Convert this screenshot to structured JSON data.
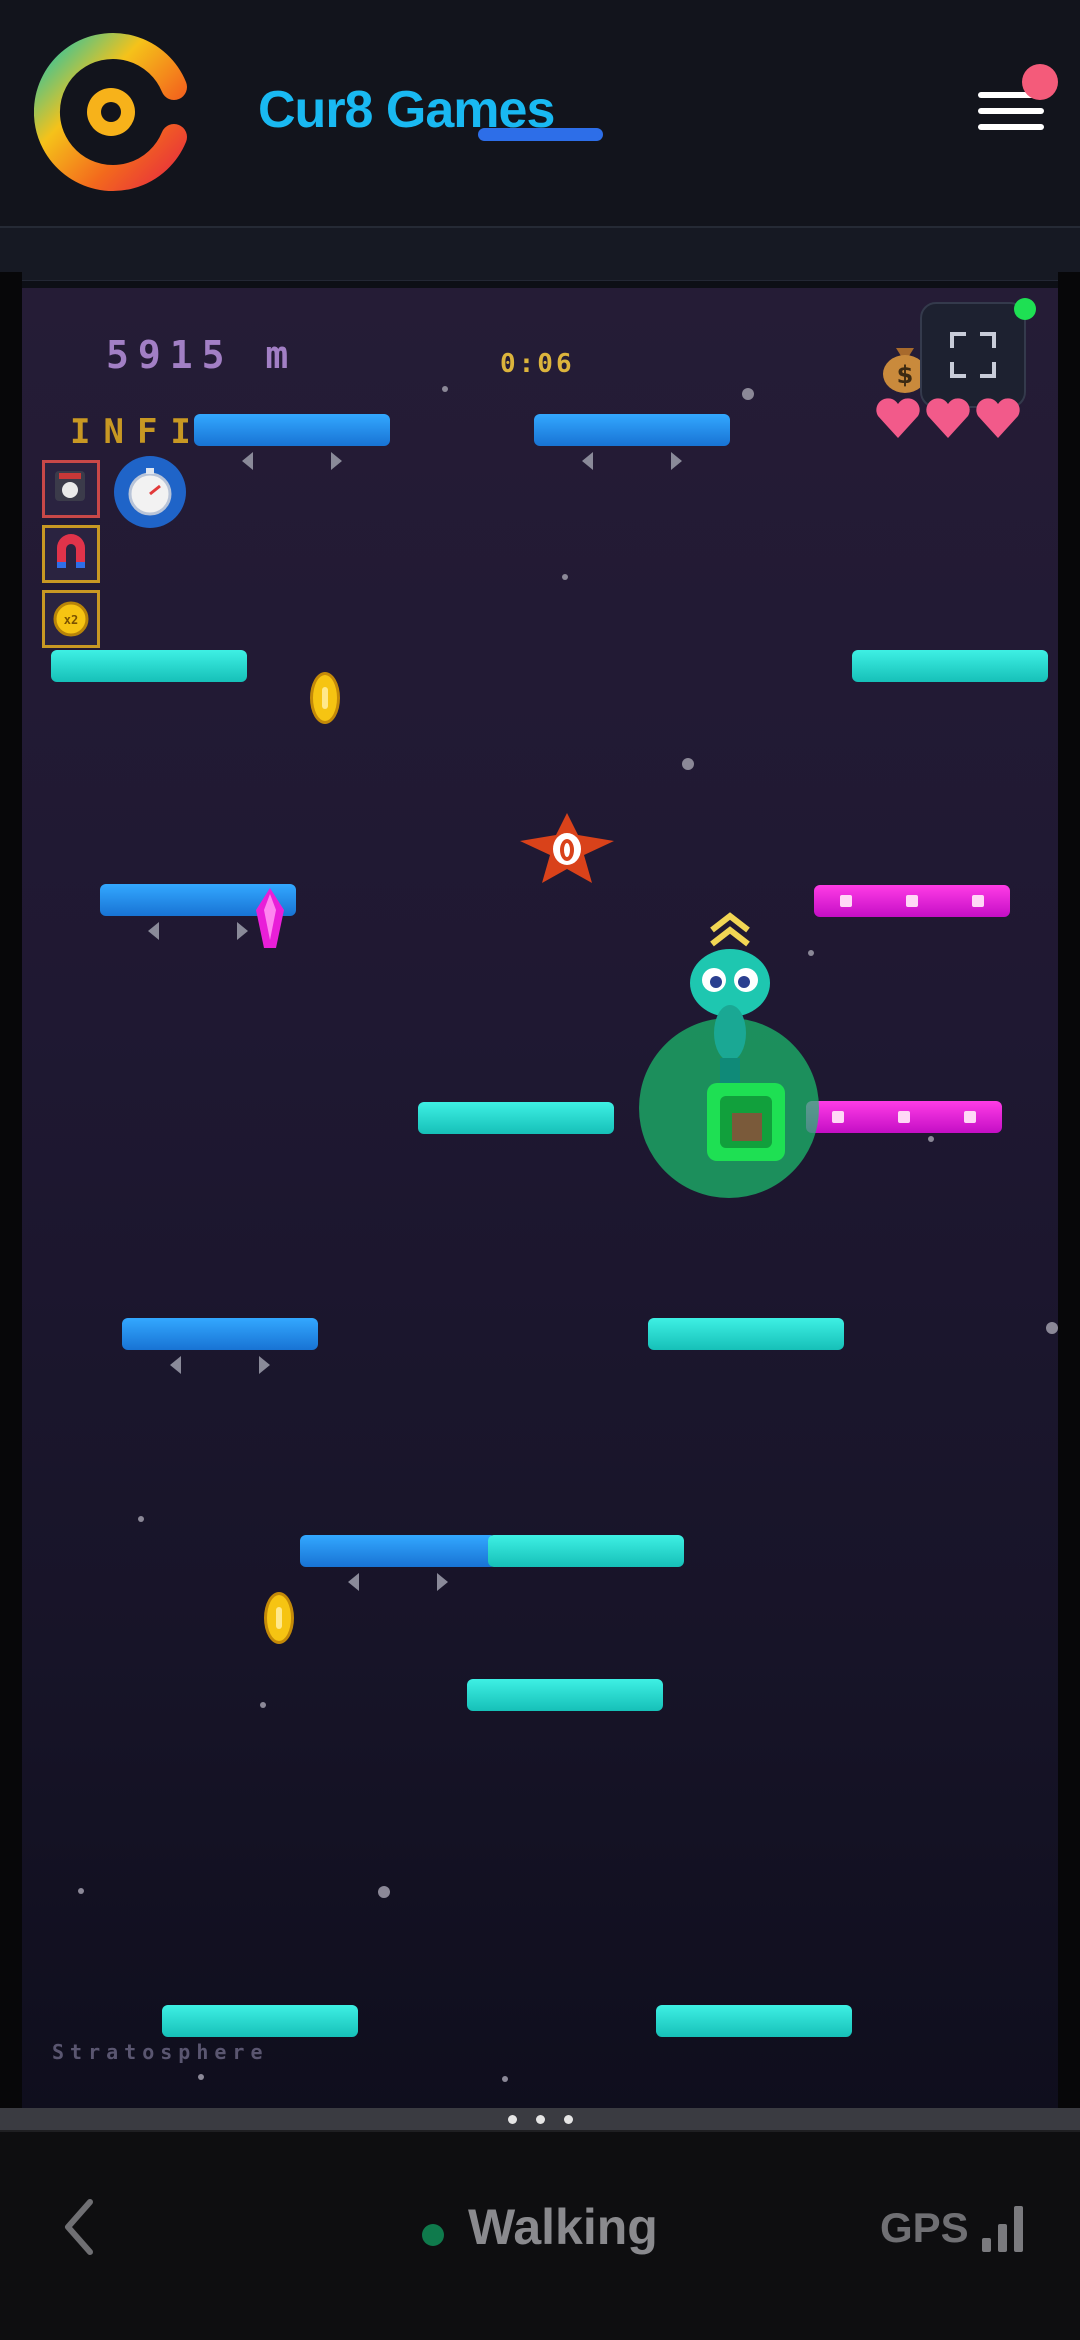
{
  "header": {
    "brand": "Cur8 Games",
    "logo_icon": "cur8-logo-icon",
    "menu_icon": "hamburger-menu-icon",
    "accent_color": "#19b9f2",
    "notification_color": "#f45b7a"
  },
  "hud": {
    "distance": "5915 m",
    "timer": "0:06",
    "mode": "INFINITE",
    "zone": "Stratosphere",
    "lives": 3,
    "fullscreen_icon": "fullscreen-icon",
    "money_icon": "money-bag-icon",
    "connection_color": "#1ee053"
  },
  "powerups": [
    "dice-powerup-icon",
    "stopwatch-powerup-icon",
    "magnet-powerup-icon",
    "coin-multiplier-powerup-icon"
  ],
  "game": {
    "platform_types": [
      "static",
      "moving",
      "crumbling"
    ],
    "platform_colors": {
      "static": "#16c0b8",
      "moving": "#1873d4",
      "crumbling": "#c40ec5"
    },
    "enemy_icon": "one-eyed-star-enemy-icon",
    "pickup_icons": [
      "coin-icon",
      "crystal-icon"
    ],
    "player_icon": "alien-player-icon",
    "shield_color": "#1cbe6e"
  },
  "footer": {
    "back_icon": "chevron-left-icon",
    "status": "Walking",
    "status_color": "#0f7a4c",
    "gps_label": "GPS",
    "signal_icon": "signal-bars-icon"
  }
}
